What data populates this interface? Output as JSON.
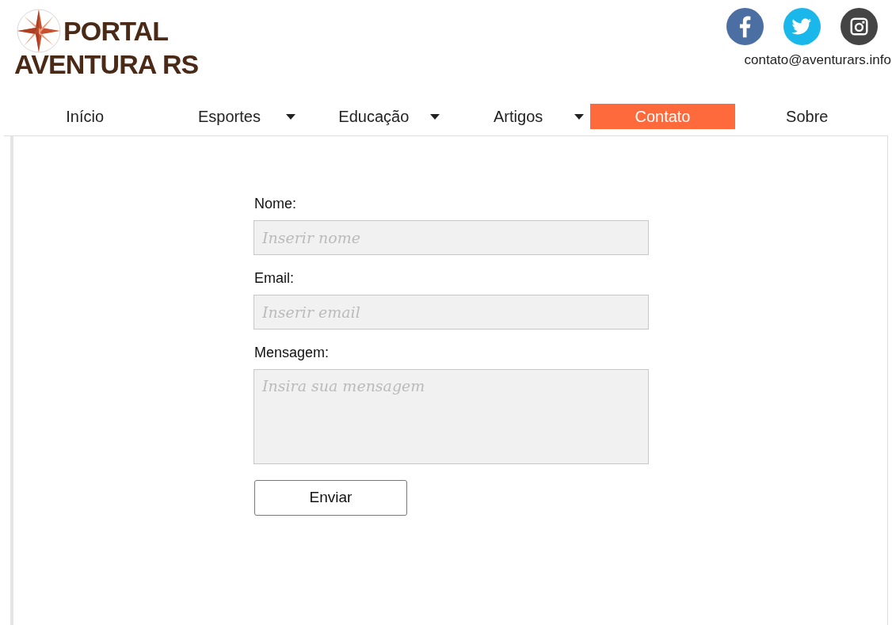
{
  "logo": {
    "line_1": "PORTAL",
    "line_2": "AVENTURA RS"
  },
  "header": {
    "email": "contato@aventurars.info"
  },
  "nav": [
    {
      "label": "Início",
      "dropdown": false,
      "selected": false
    },
    {
      "label": "Esportes",
      "dropdown": true,
      "selected": false
    },
    {
      "label": "Educação",
      "dropdown": true,
      "selected": false
    },
    {
      "label": "Artigos",
      "dropdown": true,
      "selected": false
    },
    {
      "label": "Contato",
      "dropdown": false,
      "selected": true
    },
    {
      "label": "Sobre",
      "dropdown": false,
      "selected": false
    }
  ],
  "form": {
    "fields": [
      {
        "label": "Nome:",
        "placeholder": "Inserir nome",
        "kind": "input"
      },
      {
        "label": "Email:",
        "placeholder": "Inserir email",
        "kind": "input"
      },
      {
        "label": "Mensagem:",
        "placeholder": "Insira sua mensagem",
        "kind": "textarea"
      }
    ],
    "submit": "Enviar"
  }
}
